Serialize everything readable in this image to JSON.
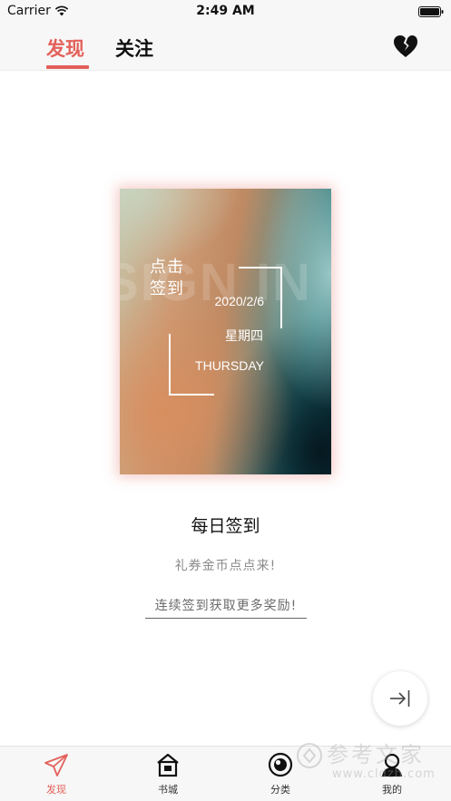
{
  "status_bar": {
    "carrier": "Carrier",
    "time": "2:49 AM"
  },
  "top_nav": {
    "tabs": [
      {
        "label": "发现",
        "active": true
      },
      {
        "label": "关注",
        "active": false
      }
    ],
    "right_icon": "heart-broken-icon",
    "accent_color": "#e4605a"
  },
  "signin_card": {
    "watermark": "SIGN IN",
    "title_line1": "点击",
    "title_line2": "签到",
    "date": "2020/2/6",
    "weekday": "星期四",
    "weekday_en": "THURSDAY"
  },
  "main": {
    "title": "每日签到",
    "subtitle": "礼券金币点点来!",
    "link": "连续签到获取更多奖励!"
  },
  "floating_button": {
    "icon": "exit-arrow-icon"
  },
  "tab_bar": {
    "items": [
      {
        "label": "发现",
        "icon": "paper-plane-icon",
        "active": true
      },
      {
        "label": "书城",
        "icon": "store-icon",
        "active": false
      },
      {
        "label": "分类",
        "icon": "category-icon",
        "active": false
      },
      {
        "label": "我的",
        "icon": "user-icon",
        "active": false
      }
    ]
  },
  "site_watermark": {
    "text": "参考文家",
    "url": "www.cldzb.com"
  }
}
